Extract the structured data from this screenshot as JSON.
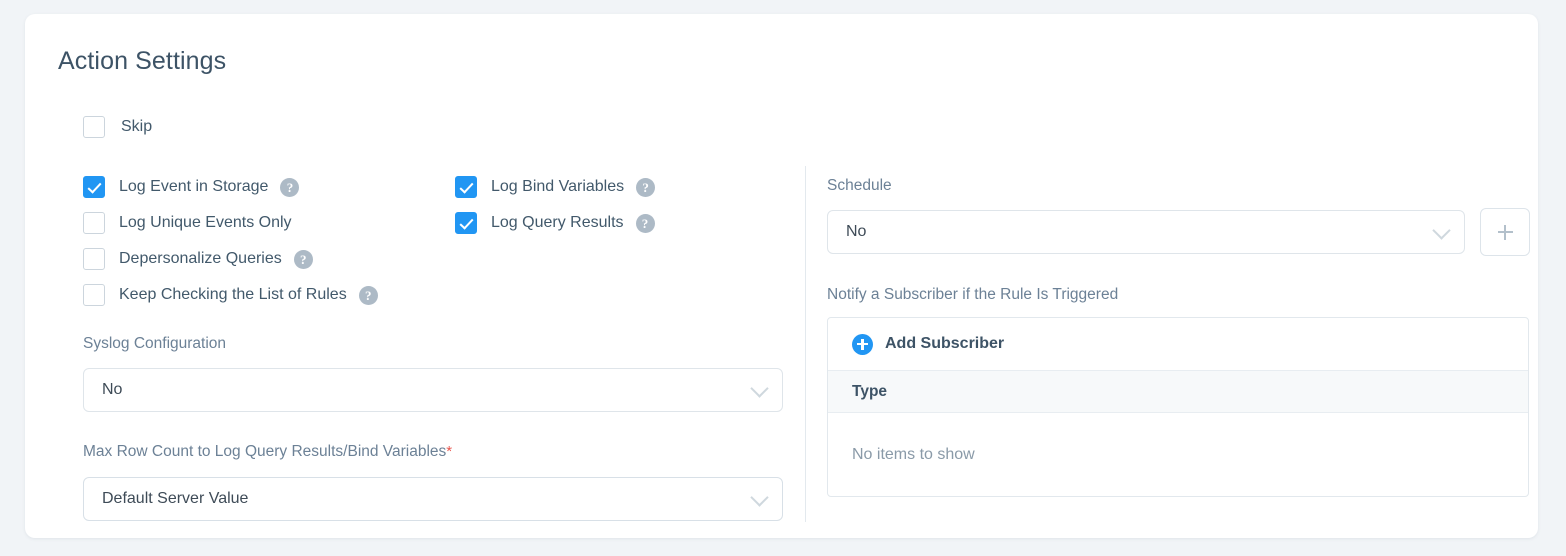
{
  "page": {
    "title": "Action Settings"
  },
  "skip": {
    "label": "Skip",
    "checked": false
  },
  "checkbox_columns": {
    "left": [
      {
        "label": "Log Event in Storage",
        "checked": true,
        "help": true,
        "help_glyph": "?"
      },
      {
        "label": "Log Unique Events Only",
        "checked": false,
        "help": false,
        "help_glyph": "?"
      },
      {
        "label": "Depersonalize Queries",
        "checked": false,
        "help": true,
        "help_glyph": "?"
      },
      {
        "label": "Keep Checking the List of Rules",
        "checked": false,
        "help": true,
        "help_glyph": "?"
      }
    ],
    "right": [
      {
        "label": "Log Bind Variables",
        "checked": true,
        "help": true,
        "help_glyph": "?"
      },
      {
        "label": "Log Query Results",
        "checked": true,
        "help": true,
        "help_glyph": "?"
      }
    ]
  },
  "syslog": {
    "label": "Syslog Configuration",
    "value": "No"
  },
  "max_row_count": {
    "label": "Max Row Count to Log Query Results/Bind Variables",
    "required_marker": "*",
    "value": "Default Server Value"
  },
  "schedule": {
    "label": "Schedule",
    "value": "No",
    "add_button_label": "+"
  },
  "notify": {
    "label": "Notify a Subscriber if the Rule Is Triggered",
    "add_subscriber_label": "Add Subscriber",
    "columns": [
      "Type"
    ],
    "rows": [],
    "empty_text": "No items to show"
  },
  "colors": {
    "accent": "#2196f3",
    "page_background": "#f1f4f7",
    "card_background": "#ffffff",
    "heading_text": "#3d5366",
    "label_text": "#6c8196",
    "required_asterisk": "#e8544c",
    "help_icon": "#adbac6",
    "table_header_background": "#f7f9fa"
  }
}
